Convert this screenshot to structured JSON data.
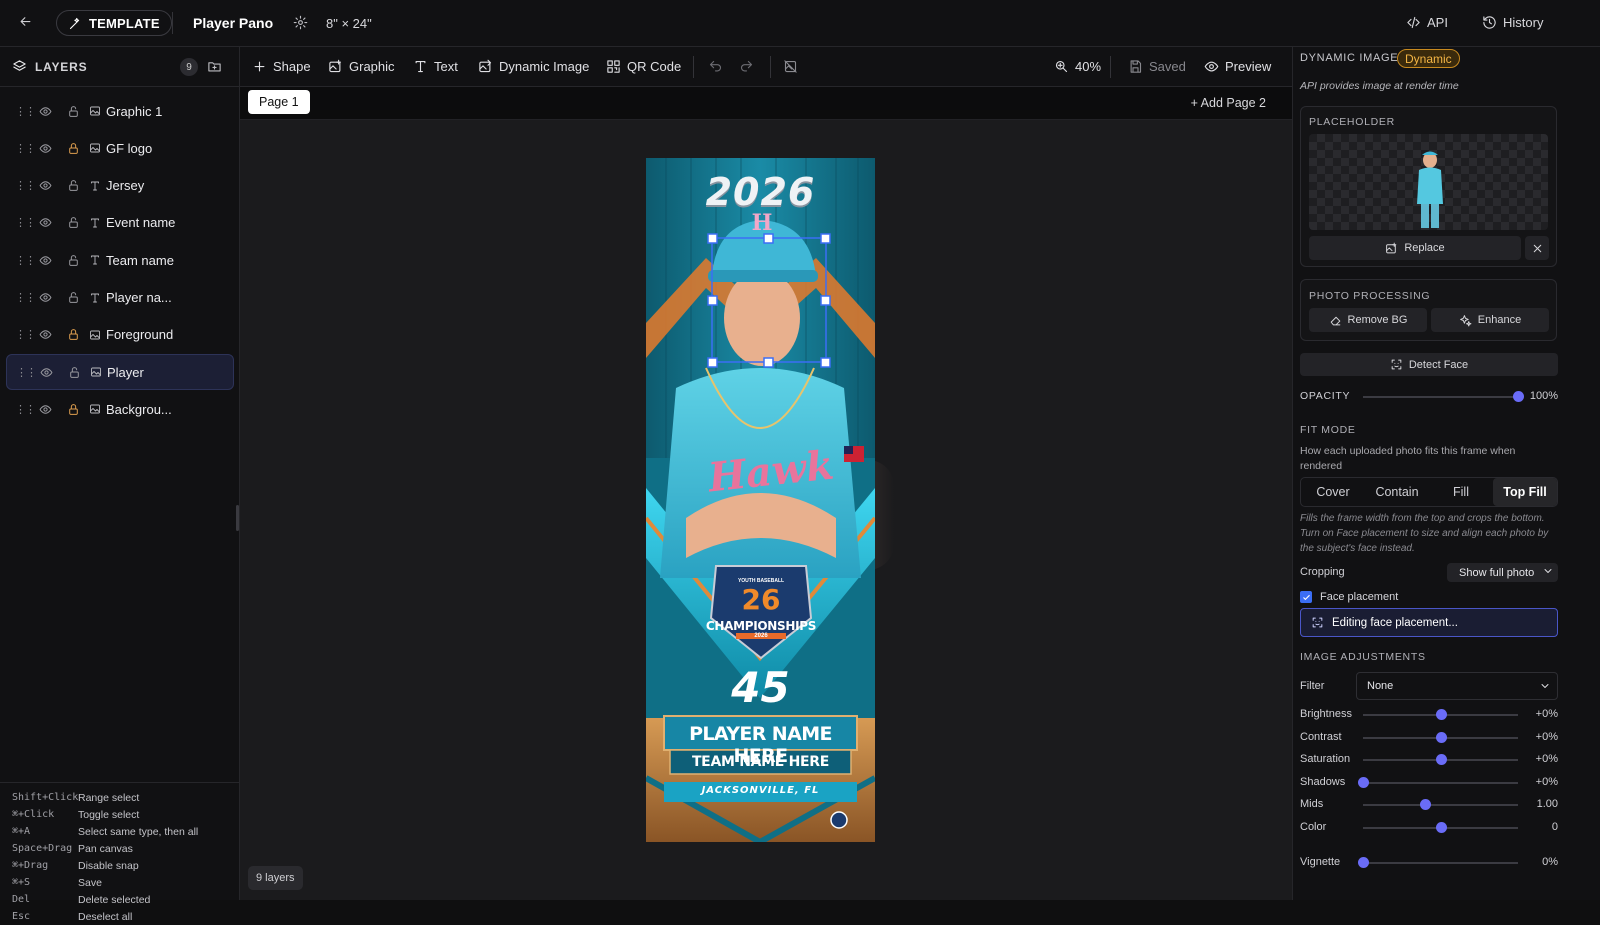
{
  "topbar": {
    "template_label": "TEMPLATE",
    "title": "Player Pano",
    "size": "8\" × 24\"",
    "api_label": "API",
    "history_label": "History"
  },
  "layers_panel": {
    "title": "LAYERS",
    "count": "9",
    "items": [
      {
        "name": "Graphic 1",
        "type": "image",
        "locked": false
      },
      {
        "name": "GF logo",
        "type": "image",
        "locked": true
      },
      {
        "name": "Jersey",
        "type": "text",
        "locked": false
      },
      {
        "name": "Event name",
        "type": "text",
        "locked": false
      },
      {
        "name": "Team name",
        "type": "text",
        "locked": false
      },
      {
        "name": "Player na...",
        "type": "text",
        "locked": false
      },
      {
        "name": "Foreground",
        "type": "image",
        "locked": true
      },
      {
        "name": "Player",
        "type": "image",
        "locked": false,
        "selected": true
      },
      {
        "name": "Backgrou...",
        "type": "image",
        "locked": true
      }
    ],
    "shortcuts": [
      {
        "key": "Shift+Click",
        "desc": "Range select"
      },
      {
        "key": "⌘+Click",
        "desc": "Toggle select"
      },
      {
        "key": "⌘+A",
        "desc": "Select same type, then all"
      },
      {
        "key": "Space+Drag",
        "desc": "Pan canvas"
      },
      {
        "key": "⌘+Drag",
        "desc": "Disable snap"
      },
      {
        "key": "⌘+S",
        "desc": "Save"
      },
      {
        "key": "Del",
        "desc": "Delete selected"
      },
      {
        "key": "Esc",
        "desc": "Deselect all"
      }
    ]
  },
  "toolbar": {
    "shape": "Shape",
    "graphic": "Graphic",
    "text": "Text",
    "dynamic_image": "Dynamic Image",
    "qr_code": "QR Code",
    "zoom": "40%",
    "saved": "Saved",
    "preview": "Preview"
  },
  "pages": {
    "tab": "Page 1",
    "add": "+ Add Page 2"
  },
  "canvas": {
    "layers_count": "9 layers",
    "card": {
      "year": "2026",
      "cap_letter": "H",
      "jersey_script": "Hawk",
      "badge_top": "YOUTH BASEBALL",
      "badge_number": "26",
      "badge_text": "CHAMPIONSHIPS",
      "badge_year": "2026",
      "number": "45",
      "player_name": "PLAYER NAME HERE",
      "team_name": "TEAM NAME HERE",
      "location": "JACKSONVILLE, FL"
    }
  },
  "inspector": {
    "section": "DYNAMIC IMAGE",
    "badge": "Dynamic",
    "subtitle": "API provides image at render time",
    "placeholder_title": "PLACEHOLDER",
    "replace": "Replace",
    "photo_processing": "PHOTO PROCESSING",
    "remove_bg": "Remove BG",
    "enhance": "Enhance",
    "detect_face": "Detect Face",
    "opacity_label": "OPACITY",
    "opacity_value": "100%",
    "opacity_fraction": 1.0,
    "fit_title": "FIT MODE",
    "fit_desc": "How each uploaded photo fits this frame when rendered",
    "fit_options": [
      "Cover",
      "Contain",
      "Fill",
      "Top Fill"
    ],
    "fit_selected": "Top Fill",
    "fit_help": "Fills the frame width from the top and crops the bottom. Turn on Face placement to size and align each photo by the subject's face instead.",
    "cropping_label": "Cropping",
    "cropping_value": "Show full photo",
    "face_placement_label": "Face placement",
    "face_placement_checked": true,
    "editing_face": "Editing face placement...",
    "adjust_title": "IMAGE ADJUSTMENTS",
    "filter_label": "Filter",
    "filter_value": "None",
    "adjustments": [
      {
        "label": "Brightness",
        "value": "+0%",
        "level": 0.5
      },
      {
        "label": "Contrast",
        "value": "+0%",
        "level": 0.5
      },
      {
        "label": "Saturation",
        "value": "+0%",
        "level": 0.5
      },
      {
        "label": "Shadows",
        "value": "+0%",
        "level": 0.0
      },
      {
        "label": "Mids",
        "value": "1.00",
        "level": 0.4
      },
      {
        "label": "Color",
        "value": "0",
        "level": 0.5
      }
    ],
    "vignette_label": "Vignette",
    "vignette_value": "0%",
    "vignette_level": 0.0
  },
  "colors": {
    "accent": "#6a6cf7",
    "dynamic_badge": "#c88a1f",
    "selected_layer": "#1c1f35"
  }
}
